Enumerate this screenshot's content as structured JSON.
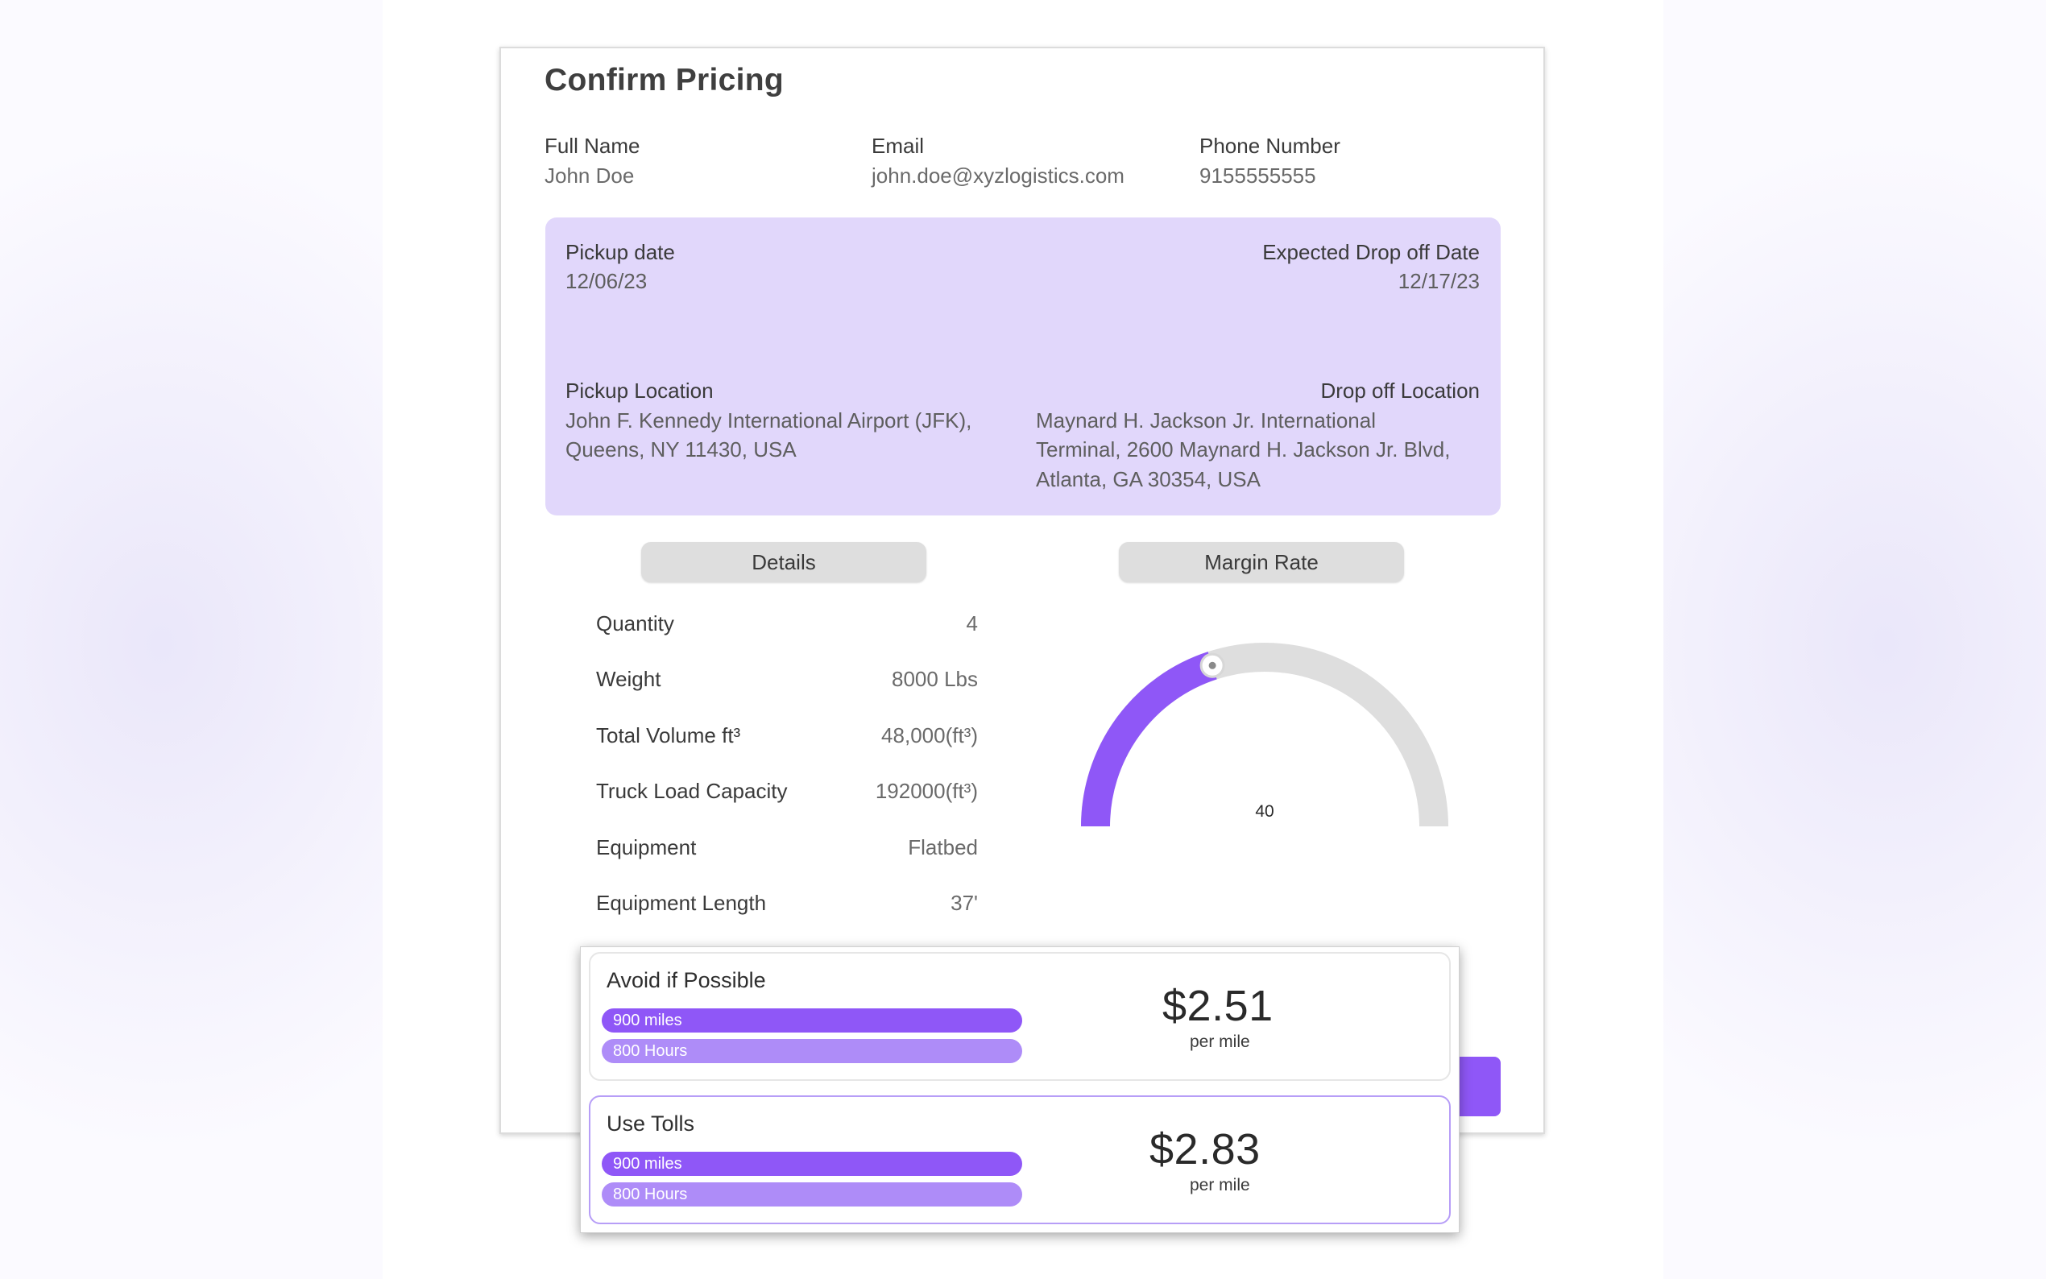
{
  "title": "Confirm Pricing",
  "contact": {
    "name_label": "Full Name",
    "name_value": "John Doe",
    "email_label": "Email",
    "email_value": "john.doe@xyzlogistics.com",
    "phone_label": "Phone Number",
    "phone_value": "9155555555"
  },
  "trip": {
    "pickup_date_label": "Pickup date",
    "pickup_date_value": "12/06/23",
    "dropoff_date_label": "Expected Drop off Date",
    "dropoff_date_value": "12/17/23",
    "pickup_location_label": "Pickup Location",
    "pickup_location_line1": "John F. Kennedy International Airport (JFK),",
    "pickup_location_line2": "Queens, NY 11430, USA",
    "dropoff_location_label": "Drop off Location",
    "dropoff_location_line1": "Maynard H. Jackson Jr. International",
    "dropoff_location_line2": "Terminal, 2600 Maynard H. Jackson Jr. Blvd,",
    "dropoff_location_line3": "Atlanta, GA 30354, USA"
  },
  "tabs": {
    "details": "Details",
    "margin_rate": "Margin Rate"
  },
  "details": [
    {
      "label": "Quantity",
      "value": "4"
    },
    {
      "label": "Weight",
      "value": "8000  Lbs"
    },
    {
      "label": "Total Volume ft³",
      "value": "48,000(ft³)"
    },
    {
      "label": "Truck Load Capacity",
      "value": "192000(ft³)"
    },
    {
      "label": "Equipment",
      "value": "Flatbed"
    },
    {
      "label": "Equipment Length",
      "value": "37'"
    }
  ],
  "margin_gauge": {
    "value": 40,
    "value_label": "40",
    "fill_fraction": 0.4,
    "fill_color": "#8f57f7",
    "track_color": "#dedede"
  },
  "route_options": [
    {
      "title": "Avoid if Possible",
      "distance": "900 miles",
      "duration": "800 Hours",
      "price": "$2.51",
      "unit": "per mile"
    },
    {
      "title": "Use Tolls",
      "distance": "900 miles",
      "duration": "800 Hours",
      "price": "$2.83",
      "unit": "per mile"
    }
  ],
  "colors": {
    "accent": "#8f57f7",
    "accent_light": "#ae8cf8",
    "panel": "#e1d7fb"
  }
}
